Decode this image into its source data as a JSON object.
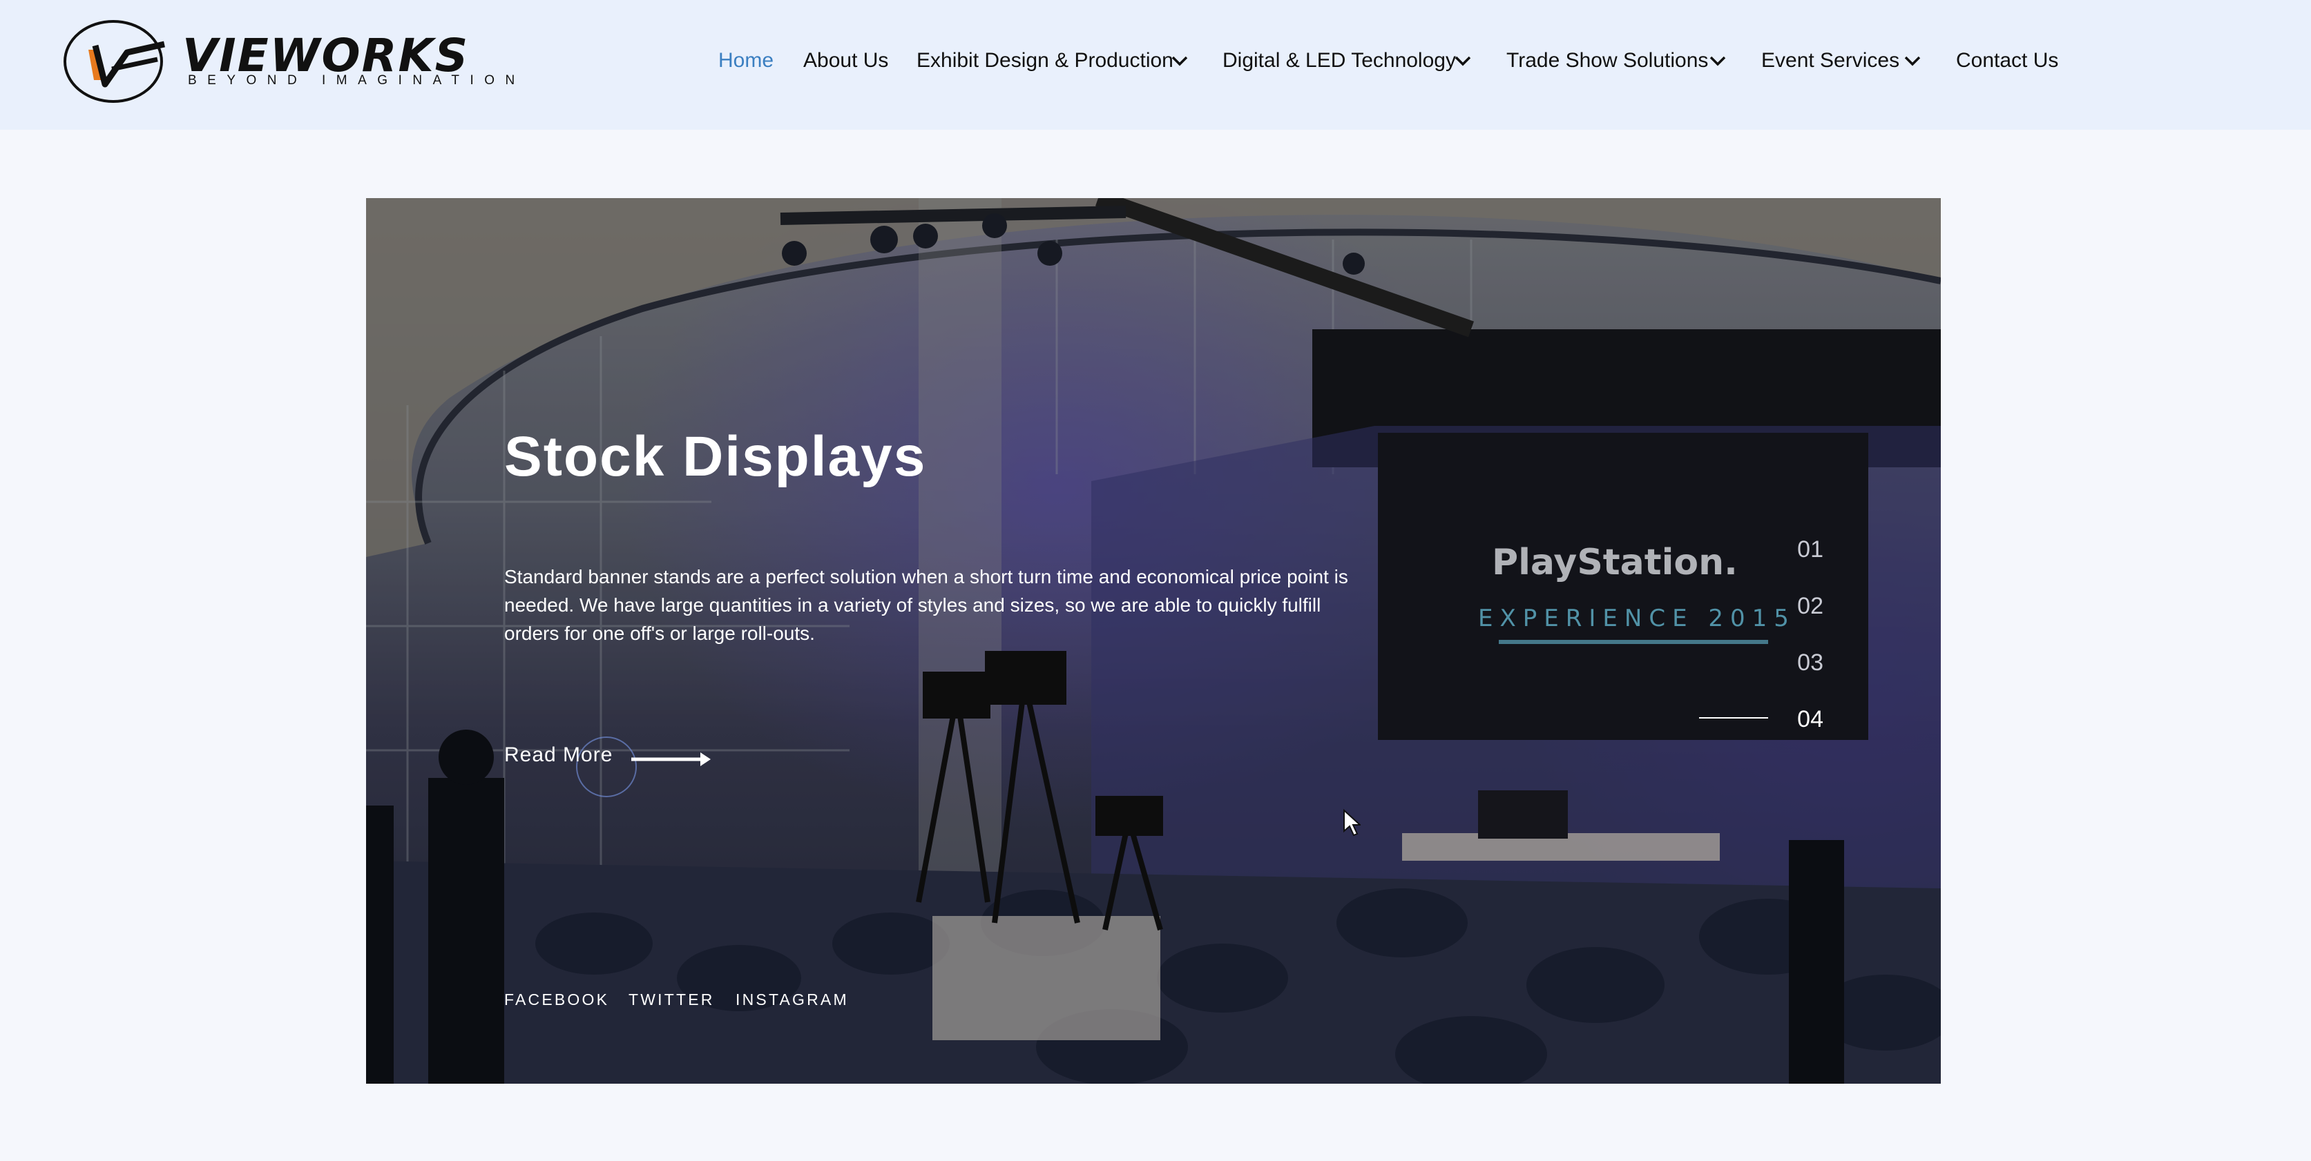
{
  "brand": {
    "name": "VIEWORKS",
    "tagline": "BEYOND IMAGINATION",
    "colors": {
      "accent": "#e87a1e",
      "ink": "#111111",
      "nav_active": "#3b7fc1"
    }
  },
  "nav": {
    "items": [
      {
        "label": "Home",
        "active": true,
        "has_dropdown": false
      },
      {
        "label": "About Us",
        "active": false,
        "has_dropdown": false
      },
      {
        "label": "Exhibit Design & Production",
        "active": false,
        "has_dropdown": true
      },
      {
        "label": "Digital & LED Technology",
        "active": false,
        "has_dropdown": true
      },
      {
        "label": "Trade Show Solutions",
        "active": false,
        "has_dropdown": true
      },
      {
        "label": "Event Services",
        "active": false,
        "has_dropdown": true
      },
      {
        "label": "Contact Us",
        "active": false,
        "has_dropdown": false
      }
    ],
    "dropdown_icon": "chevron-down-icon"
  },
  "hero": {
    "title": "Stock Displays",
    "description": "Standard banner stands are a perfect solution when a short turn time and economical price point is needed. We have large quantities in a variety of styles and sizes, so we are able to quickly fulfill orders for one off's or large roll-outs.",
    "read_more": "Read More",
    "arrow_icon": "arrow-right-icon",
    "social": [
      "FACEBOOK",
      "TWITTER",
      "INSTAGRAM"
    ],
    "slides": [
      "01",
      "02",
      "03",
      "04"
    ],
    "active_slide": "04",
    "background_text": {
      "brand": "PlayStation.",
      "subtitle": "EXPERIENCE 2015"
    }
  }
}
